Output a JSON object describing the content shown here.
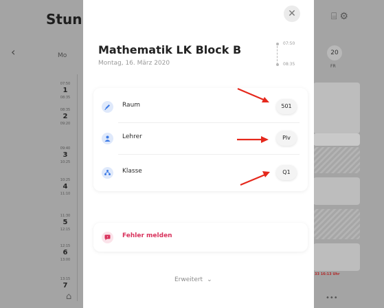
{
  "background": {
    "app_title": "Stun",
    "back_icon": "chevron-left-icon",
    "day_label": "Mo",
    "periods": [
      {
        "start": "07:50",
        "number": "1",
        "end": "08:35"
      },
      {
        "start": "08:35",
        "number": "2",
        "end": "09:20"
      },
      {
        "start": "09:40",
        "number": "3",
        "end": "10:25"
      },
      {
        "start": "10:25",
        "number": "4",
        "end": "11:10"
      },
      {
        "start": "11:30",
        "number": "5",
        "end": "12:15"
      },
      {
        "start": "12:15",
        "number": "6",
        "end": "13:00"
      },
      {
        "start": "13:15",
        "number": "7",
        "end": ""
      }
    ],
    "date_number": "20",
    "weekday": "FR",
    "red_notice": "33 16:13 Uhr"
  },
  "modal": {
    "title": "Mathematik LK Block B",
    "date": "Montag, 16. März 2020",
    "time_start": "07:50",
    "time_end": "08:35",
    "close_icon": "close-icon",
    "rows": [
      {
        "label": "Raum",
        "value": "501",
        "icon": "pencil-icon"
      },
      {
        "label": "Lehrer",
        "value": "Plv",
        "icon": "person-icon"
      },
      {
        "label": "Klasse",
        "value": "Q1",
        "icon": "group-icon"
      }
    ],
    "error_label": "Fehler melden",
    "error_icon": "chat-bubble-icon",
    "extended_label": "Erweitert"
  },
  "colors": {
    "accent_blue": "#3d7be6",
    "error_red": "#d8315b",
    "arrow_red": "#e5281c"
  }
}
